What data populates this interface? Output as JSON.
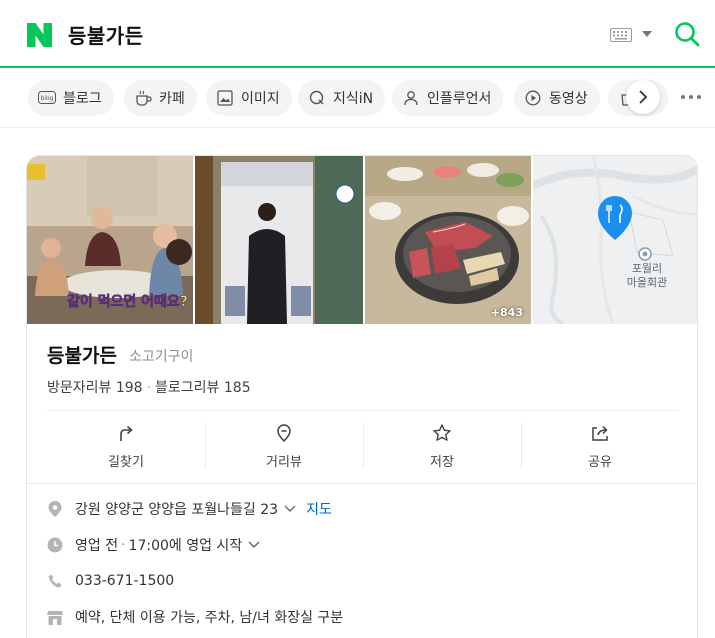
{
  "header": {
    "query": "등불가든",
    "logo": "naver-n-logo",
    "brand_color": "#03c75a"
  },
  "tabs": [
    {
      "label": "블로그",
      "icon": "blog-icon"
    },
    {
      "label": "카페",
      "icon": "cafe-cup-icon"
    },
    {
      "label": "이미지",
      "icon": "image-icon"
    },
    {
      "label": "지식iN",
      "icon": "knowledge-q-icon"
    },
    {
      "label": "인플루언서",
      "icon": "person-icon"
    },
    {
      "label": "동영상",
      "icon": "play-icon"
    }
  ],
  "place": {
    "photo_count": "+843",
    "photo_captions": [
      "같이 먹으면 어때요?"
    ],
    "map_label": "포월리 마을회관",
    "name": "등불가든",
    "category": "소고기구이",
    "visitor_reviews": "방문자리뷰 198",
    "blog_reviews": "블로그리뷰 185",
    "actions": [
      {
        "label": "길찾기",
        "icon": "directions-icon"
      },
      {
        "label": "거리뷰",
        "icon": "street-view-icon"
      },
      {
        "label": "저장",
        "icon": "star-icon"
      },
      {
        "label": "공유",
        "icon": "share-icon"
      }
    ],
    "address": "강원 양양군 양양읍 포월나들길 23",
    "map_link": "지도",
    "hours_status": "영업 전",
    "hours_detail": "17:00에 영업 시작",
    "phone": "033-671-1500",
    "amenities": "예약, 단체 이용 가능, 주차, 남/녀 화장실 구분"
  }
}
